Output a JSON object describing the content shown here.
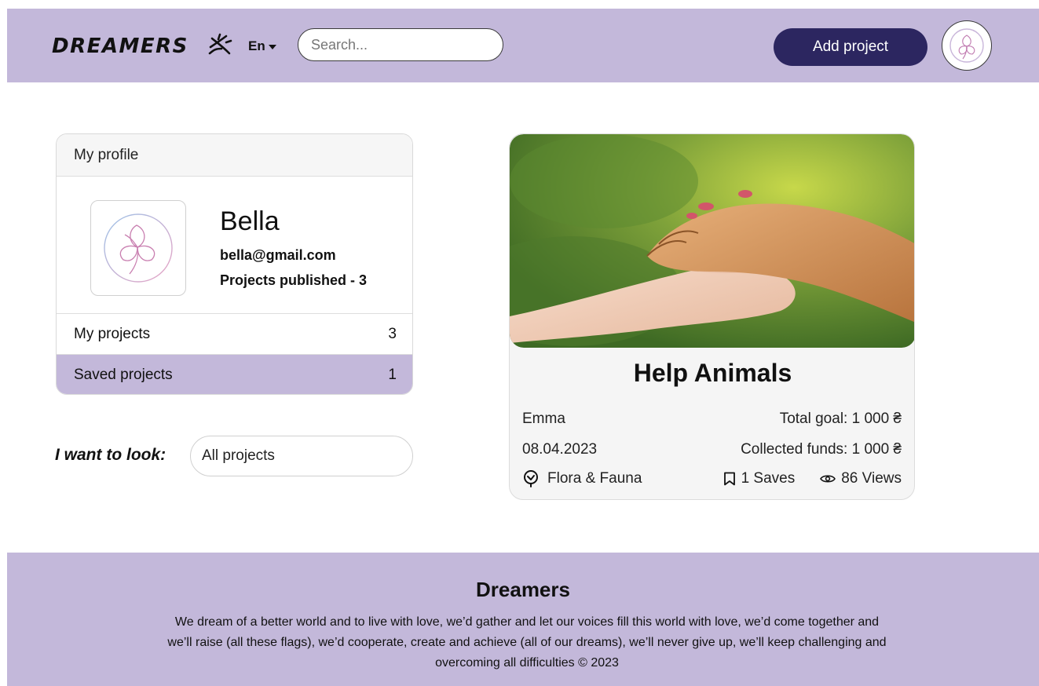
{
  "header": {
    "logo": "DREAMERS",
    "lang": "En",
    "search_placeholder": "Search...",
    "add_project": "Add project"
  },
  "profile": {
    "heading": "My profile",
    "name": "Bella",
    "email": "bella@gmail.com",
    "published": "Projects published - 3",
    "rows": [
      {
        "label": "My projects",
        "count": "3"
      },
      {
        "label": "Saved projects",
        "count": "1"
      }
    ]
  },
  "filter": {
    "label": "I want to look:",
    "value": "All projects"
  },
  "project": {
    "title": "Help Animals",
    "author": "Emma",
    "date": "08.04.2023",
    "goal": "Total goal: 1 000 ₴",
    "funds": "Collected funds: 1 000 ₴",
    "category": "Flora & Fauna",
    "saves": "1 Saves",
    "views": "86 Views"
  },
  "footer": {
    "title": "Dreamers",
    "text": "We dream of a better world and to live with love, we’d gather and let our voices fill this world with love, we’d come together and we’ll raise (all these flags), we’d cooperate, create and achieve (all of our dreams), we’ll never give up, we’ll keep challenging and overcoming all difficulties © 2023"
  },
  "colors": {
    "accent_lavender": "#c3b8da",
    "button_navy": "#2c2660"
  }
}
